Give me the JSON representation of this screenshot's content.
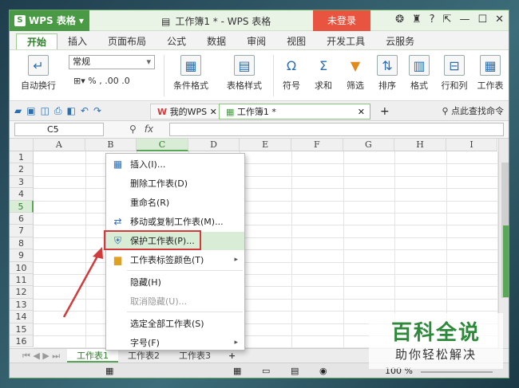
{
  "titlebar": {
    "app_name": "WPS 表格",
    "doc_title": "工作簿1 * - WPS 表格",
    "login": "未登录",
    "controls": [
      "?"
    ]
  },
  "menu": {
    "tabs": [
      "开始",
      "插入",
      "页面布局",
      "公式",
      "数据",
      "审阅",
      "视图",
      "开发工具",
      "云服务"
    ]
  },
  "ribbon": {
    "wrap": "自动换行",
    "font_style": "常规",
    "percent": "%",
    "cond_format": "条件格式",
    "table_style": "表格样式",
    "symbol": "符号",
    "sum": "求和",
    "filter": "筛选",
    "sort": "排序",
    "format": "格式",
    "rowcol": "行和列",
    "worksheet": "工作表"
  },
  "docbar": {
    "tab1": "我的WPS",
    "tab2": "工作簿1 *",
    "search": "点此查找命令"
  },
  "formulabar": {
    "cell_ref": "C5",
    "fx": "fx"
  },
  "grid": {
    "columns": [
      "A",
      "B",
      "C",
      "D",
      "E",
      "F",
      "G",
      "H",
      "I"
    ],
    "rows": [
      "1",
      "2",
      "3",
      "4",
      "5",
      "6",
      "7",
      "8",
      "9",
      "10",
      "11",
      "12",
      "13",
      "14",
      "15",
      "16"
    ],
    "selected_col": "C",
    "selected_row": "5"
  },
  "sheets": [
    "工作表1",
    "工作表2",
    "工作表3"
  ],
  "status": {
    "zoom": "100 %"
  },
  "context_menu": [
    {
      "label": "插入(I)...",
      "icon": "table-icon"
    },
    {
      "label": "删除工作表(D)"
    },
    {
      "label": "重命名(R)"
    },
    {
      "label": "移动或复制工作表(M)...",
      "icon": "move-icon"
    },
    {
      "label": "保护工作表(P)...",
      "icon": "protect-icon",
      "highlight": true
    },
    {
      "label": "工作表标签颜色(T)",
      "icon": "color-icon",
      "submenu": true
    },
    {
      "label": "隐藏(H)"
    },
    {
      "label": "取消隐藏(U)...",
      "disabled": true
    },
    {
      "label": "选定全部工作表(S)"
    },
    {
      "label": "字号(F)",
      "submenu": true
    }
  ],
  "watermark": {
    "brand": "百科全说",
    "slogan": "助你轻松解决"
  },
  "colors": {
    "accent": "#5aa75a",
    "highlight_box": "#d13b3b",
    "login_bg": "#e8543f"
  }
}
